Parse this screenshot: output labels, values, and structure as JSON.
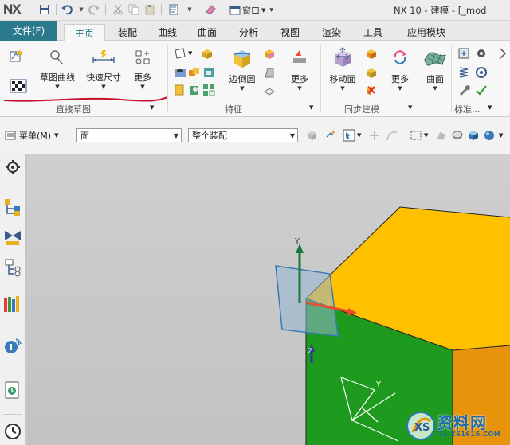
{
  "app": {
    "logo": "NX",
    "window_title": "NX 10 - 建模 - [_mod",
    "window_menu": "窗口"
  },
  "file_tab": "文件(F)",
  "tabs": [
    {
      "label": "主页",
      "active": true
    },
    {
      "label": "装配"
    },
    {
      "label": "曲线"
    },
    {
      "label": "曲面"
    },
    {
      "label": "分析"
    },
    {
      "label": "视图"
    },
    {
      "label": "渲染"
    },
    {
      "label": "工具"
    },
    {
      "label": "应用模块"
    }
  ],
  "ribbon": {
    "direct_sketch": {
      "sketch_curve": "草图曲线",
      "quick_dimension": "快速尺寸",
      "more": "更多",
      "group_label": "直接草图"
    },
    "feature": {
      "edge_blend": "边倒圆",
      "more": "更多",
      "group_label": "特征"
    },
    "sync": {
      "move_face": "移动面",
      "more": "更多",
      "group_label": "同步建模"
    },
    "surface": {
      "label": "曲面",
      "group_label": "标准..."
    }
  },
  "cmdbar": {
    "menu_label": "菜单(M)",
    "filter_value": "面",
    "scope_value": "整个装配"
  },
  "watermark": {
    "text": "资料网",
    "url": "ZL.XS1616.COM"
  },
  "colors": {
    "file_tab": "#2b7a8c",
    "red_underline": "#c8102e",
    "cube_top": "#ffc000",
    "cube_front": "#1e9a1e",
    "cube_side": "#e8940a"
  }
}
